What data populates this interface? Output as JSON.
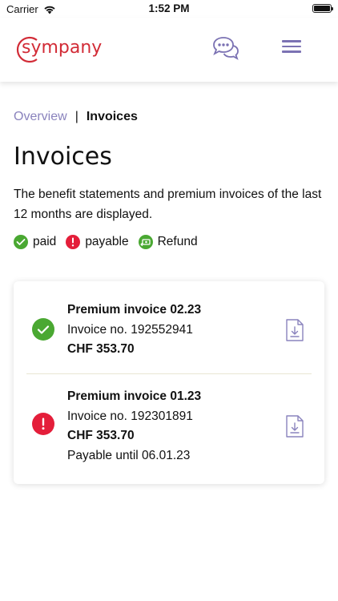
{
  "status_bar": {
    "carrier": "Carrier",
    "time": "1:52 PM"
  },
  "header": {
    "logo_text": "sympany",
    "brand_color": "#d22b36",
    "accent_color": "#7b72b3"
  },
  "breadcrumb": {
    "overview": "Overview",
    "separator": "|",
    "current": "Invoices"
  },
  "page": {
    "title": "Invoices",
    "description": "The benefit statements and premium invoices of the last 12 months are displayed."
  },
  "legend": {
    "paid": "paid",
    "payable": "payable",
    "refund": "Refund",
    "colors": {
      "paid": "#4aa832",
      "payable": "#e41e3a",
      "refund": "#4aa832"
    }
  },
  "invoices": [
    {
      "status": "paid",
      "title": "Premium invoice 02.23",
      "number": "Invoice no. 192552941",
      "amount": "CHF 353.70"
    },
    {
      "status": "payable",
      "title": "Premium invoice 01.23",
      "number": "Invoice no. 192301891",
      "amount": "CHF 353.70",
      "due": "Payable until 06.01.23"
    }
  ]
}
